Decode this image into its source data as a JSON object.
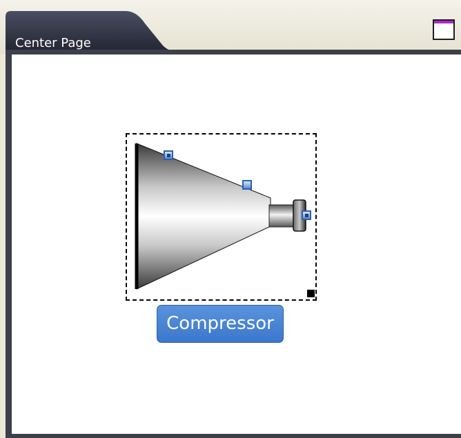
{
  "tab": {
    "label": "Center Page"
  },
  "window_controls": {
    "maximize_icon": "maximize-icon"
  },
  "component": {
    "label": "Compressor",
    "icon": "compressor-icon",
    "port_icon": "connection-port-icon"
  },
  "colors": {
    "tab_background": "#2e3142",
    "tab_strip": "#ece9d8",
    "canvas_background": "#ffffff",
    "label_background": "#4a86d6",
    "label_text": "#ffffff",
    "maximize_accent": "#b026c9"
  }
}
